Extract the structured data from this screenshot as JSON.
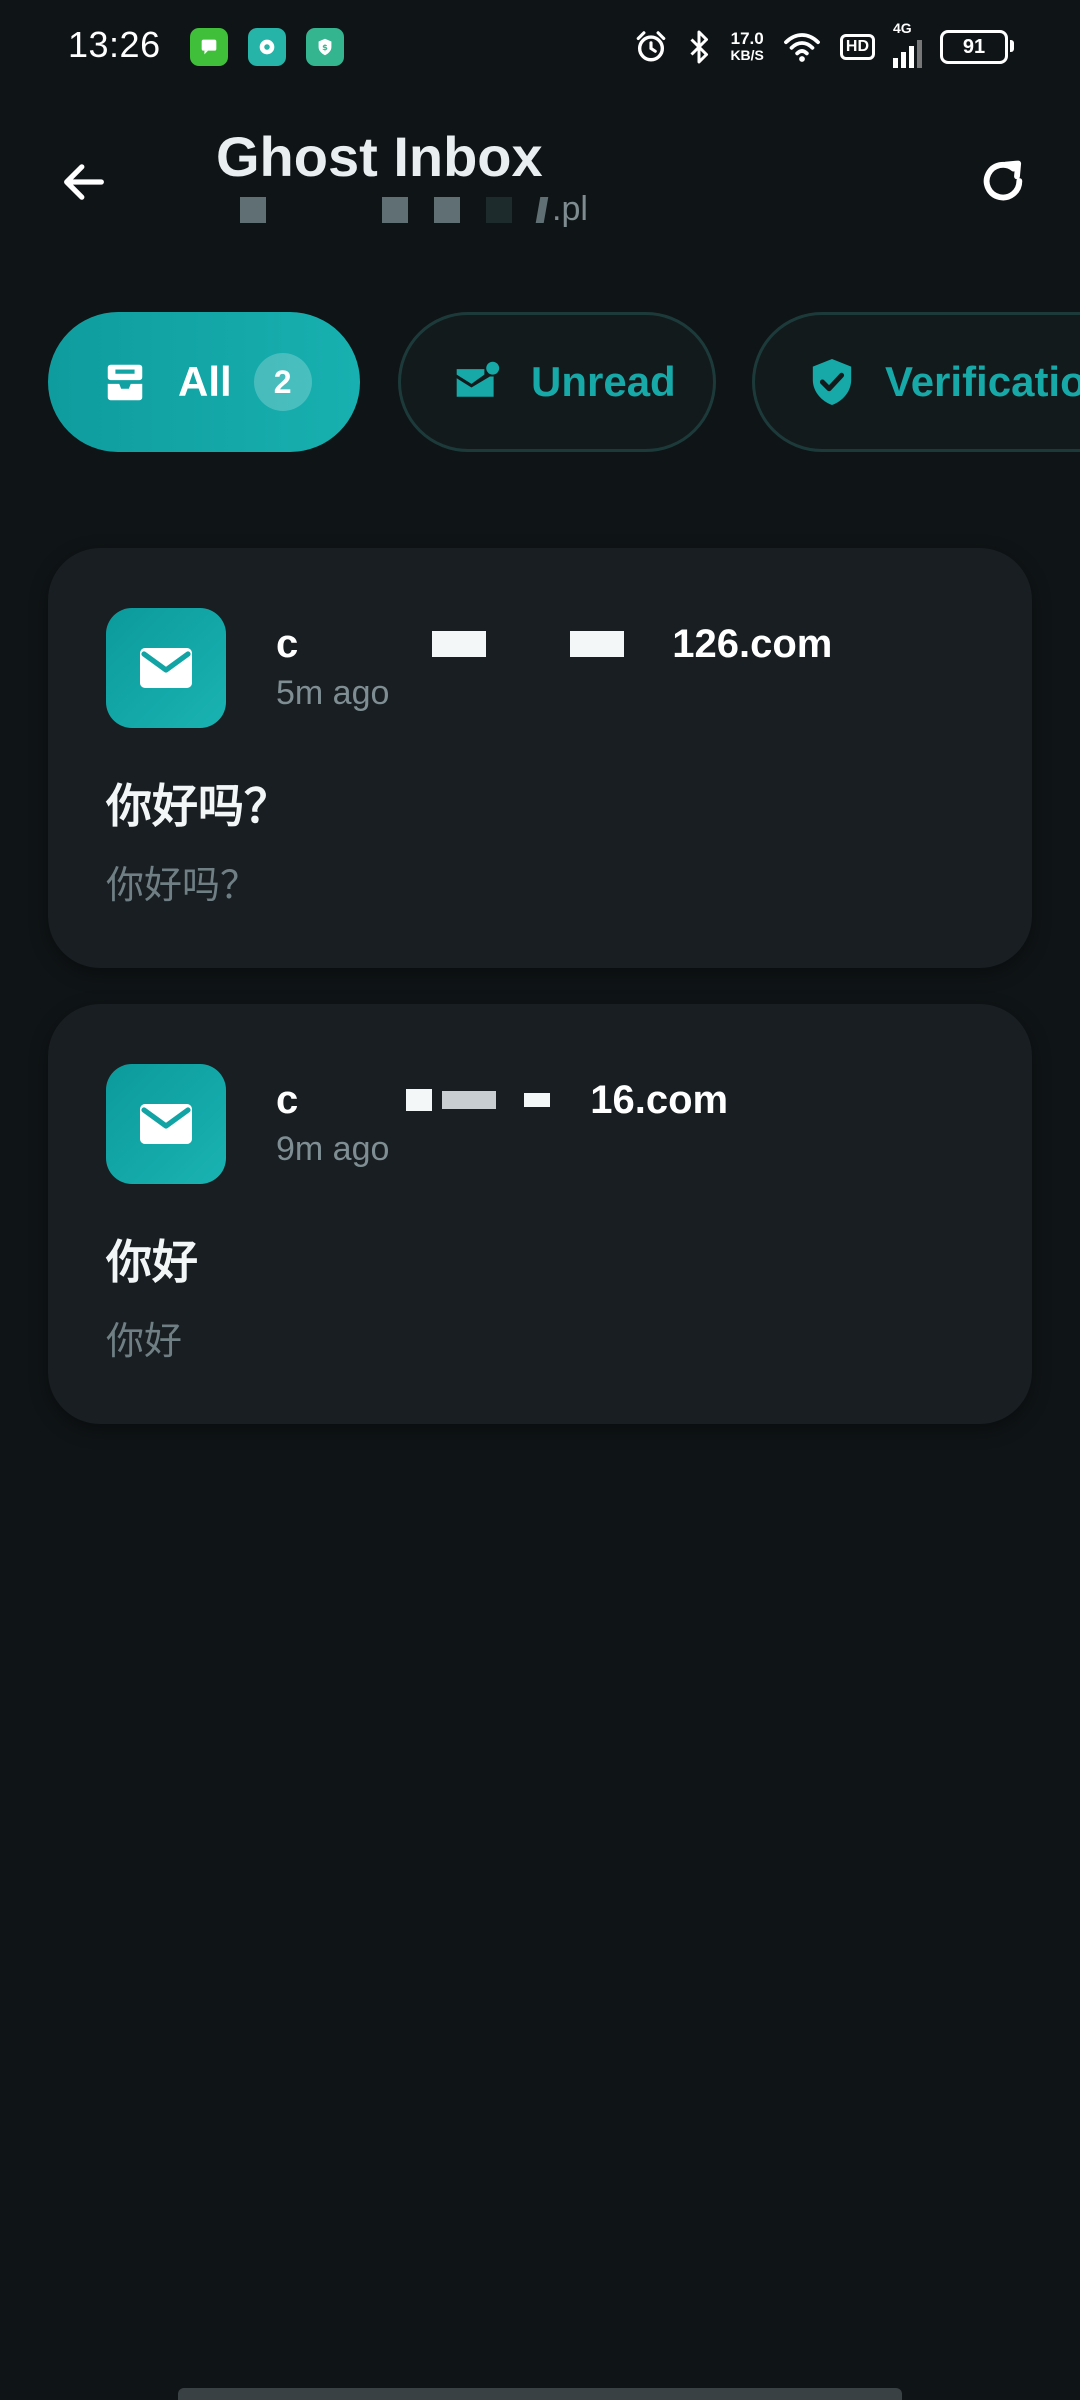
{
  "status_bar": {
    "time": "13:26",
    "net_speed_value": "17.0",
    "net_speed_unit": "KB/S",
    "hd": "HD",
    "network": "4G",
    "battery": "91"
  },
  "app_bar": {
    "title": "Ghost Inbox",
    "subtitle_suffix": ".pl"
  },
  "filters": {
    "all": {
      "label": "All",
      "count": "2"
    },
    "unread": {
      "label": "Unread"
    },
    "verification": {
      "label": "Verification"
    }
  },
  "emails": [
    {
      "sender_start": "c",
      "sender_end": "126.com",
      "time_ago": "5m ago",
      "subject": "你好吗？",
      "preview": "你好吗？"
    },
    {
      "sender_start": "c",
      "sender_end": "16.com",
      "time_ago": "9m ago",
      "subject": "你好",
      "preview": "你好"
    }
  ],
  "colors": {
    "background": "#0f1416",
    "card": "#181e21",
    "accent": "#17a8a8",
    "secondary_text": "#7f8e93"
  },
  "icons": {
    "back": "arrow-left-icon",
    "refresh": "refresh-icon",
    "all": "inbox-tray-icon",
    "unread": "mail-dot-icon",
    "verification": "shield-check-icon",
    "mail": "mail-icon"
  }
}
